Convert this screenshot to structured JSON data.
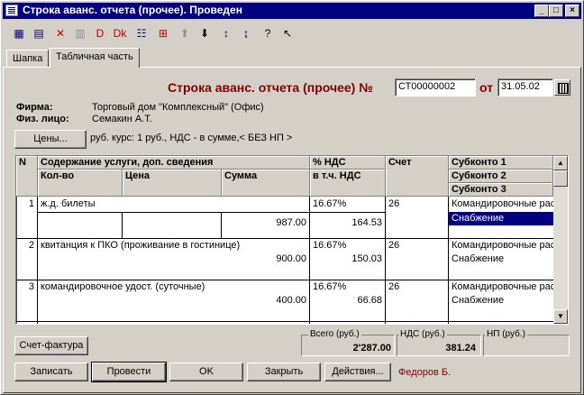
{
  "window": {
    "title": "Строка аванс. отчета (прочее). Проведен"
  },
  "tabs": [
    "Шапка",
    "Табличная часть"
  ],
  "header": {
    "doc_label": "Строка аванс. отчета (прочее) №",
    "doc_number": "СТ00000002",
    "date_label": "от",
    "date_value": "31.05.02"
  },
  "info": {
    "firm_label": "Фирма:",
    "firm_value": "Торговый дом \"Комплексный\" (Офис)",
    "person_label": "Физ. лицо:",
    "person_value": "Семакин А.Т.",
    "prices_button": "Цены...",
    "prices_text": "руб. курс: 1 руб., НДС - в сумме,< БЕЗ НП >"
  },
  "grid": {
    "headers": {
      "n": "N",
      "content": "Содержание услуги, доп. сведения",
      "qty": "Кол-во",
      "price": "Цена",
      "sum": "Сумма",
      "vat_pct": "% НДС",
      "vat_incl": "в т.ч. НДС",
      "account": "Счет",
      "sub1": "Субконто 1",
      "sub2": "Субконто 2",
      "sub3": "Субконто 3"
    },
    "rows": [
      {
        "n": "1",
        "content": "ж.д. билеты",
        "sum": "987.00",
        "vat_pct": "16.67%",
        "vat": "164.53",
        "account": "26",
        "sub1": "Командировочные рас",
        "sub2": "Снабжение"
      },
      {
        "n": "2",
        "content": "квитанция к ПКО (проживание в гостинице)",
        "sum": "900.00",
        "vat_pct": "16.67%",
        "vat": "150.03",
        "account": "26",
        "sub1": "Командировочные рас",
        "sub2": "Снабжение"
      },
      {
        "n": "3",
        "content": "командировочное удост. (суточные)",
        "sum": "400.00",
        "vat_pct": "16.67%",
        "vat": "66.68",
        "account": "26",
        "sub1": "Командировочные рас",
        "sub2": "Снабжение"
      }
    ]
  },
  "totals": {
    "total_label": "Всего (руб.)",
    "total_value": "2'287.00",
    "vat_label": "НДС (руб.)",
    "vat_value": "381.24",
    "np_label": "НП (руб.)",
    "np_value": ""
  },
  "buttons": {
    "invoice": "Счет-фактура",
    "save": "Записать",
    "post": "Провести",
    "ok": "OK",
    "close": "Закрыть",
    "actions": "Действия..."
  },
  "author": "Федоров Б."
}
